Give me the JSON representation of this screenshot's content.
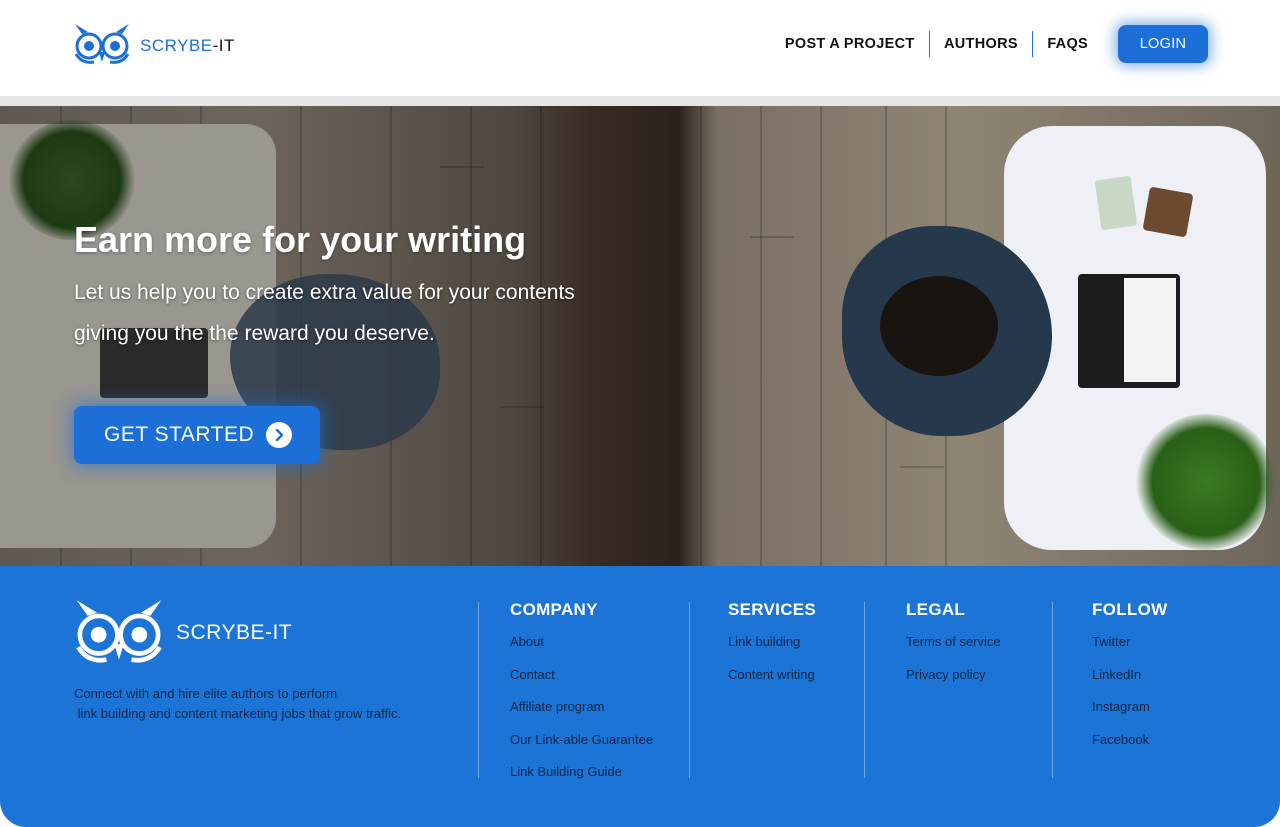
{
  "brand": {
    "name_main": "SCRYBE",
    "name_suffix": "-IT",
    "footer_name": "SCRYBE-IT"
  },
  "nav": {
    "items": [
      {
        "label": "POST A PROJECT"
      },
      {
        "label": "AUTHORS"
      },
      {
        "label": "FAQS"
      }
    ],
    "login_label": "LOGIN"
  },
  "hero": {
    "title_strong": "Earn more",
    "title_rest": " for your writing",
    "subtitle_line1": "Let us help you  to create extra value for your contents",
    "subtitle_line2": "giving you the the reward you deserve.",
    "cta_label": "GET STARTED"
  },
  "footer": {
    "description_line1": "Connect with and hire elite authors to perform",
    "description_line2": " link building and content marketing jobs that grow traffic.",
    "columns": [
      {
        "heading": "COMPANY",
        "links": [
          "About",
          "Contact",
          "Affiliate program",
          "Our Link-able Guarantee",
          "Link Building Guide"
        ]
      },
      {
        "heading": "SERVICES",
        "links": [
          "Link building",
          "Content writing"
        ]
      },
      {
        "heading": "LEGAL",
        "links": [
          "Terms of service",
          "Privacy policy"
        ]
      },
      {
        "heading": "FOLLOW",
        "links": [
          "Twitter",
          "LinkedIn",
          "Instagram",
          "Facebook"
        ]
      }
    ]
  },
  "colors": {
    "brand_blue": "#1b6fd6",
    "footer_blue": "#1b74d6",
    "footer_text": "#0c2747"
  },
  "icons": {
    "logo": "owl-logo-icon",
    "cta": "chevron-right-circle-icon"
  }
}
